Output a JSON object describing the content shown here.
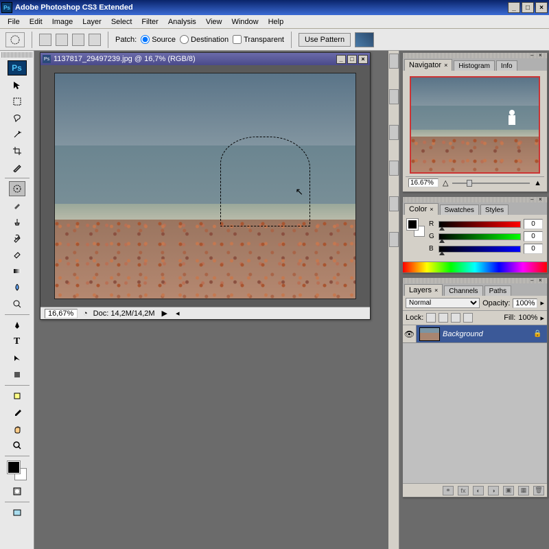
{
  "app": {
    "title": "Adobe Photoshop CS3 Extended",
    "logo": "Ps"
  },
  "menu": [
    "File",
    "Edit",
    "Image",
    "Layer",
    "Select",
    "Filter",
    "Analysis",
    "View",
    "Window",
    "Help"
  ],
  "options": {
    "patch_label": "Patch:",
    "source": "Source",
    "destination": "Destination",
    "transparent": "Transparent",
    "use_pattern": "Use Pattern"
  },
  "document": {
    "title": "1137817_29497239.jpg @ 16,7% (RGB/8)",
    "zoom": "16,67%",
    "doc_size": "Doc: 14,2M/14,2M"
  },
  "navigator": {
    "tab_nav": "Navigator",
    "tab_hist": "Histogram",
    "tab_info": "Info",
    "zoom": "16.67%"
  },
  "color": {
    "tab_color": "Color",
    "tab_swatches": "Swatches",
    "tab_styles": "Styles",
    "r_label": "R",
    "r_val": "0",
    "g_label": "G",
    "g_val": "0",
    "b_label": "B",
    "b_val": "0"
  },
  "layers": {
    "tab_layers": "Layers",
    "tab_channels": "Channels",
    "tab_paths": "Paths",
    "blend": "Normal",
    "opacity_label": "Opacity:",
    "opacity": "100%",
    "lock_label": "Lock:",
    "fill_label": "Fill:",
    "fill": "100%",
    "bg_layer": "Background"
  },
  "tools": {
    "move": "↖",
    "marquee": "⬚",
    "lasso": "⌇",
    "wand": "✦",
    "crop": "✂",
    "slice": "✄",
    "heal": "⌀",
    "brush": "🖌",
    "stamp": "⌘",
    "history": "↺",
    "eraser": "▱",
    "gradient": "▦",
    "blur": "●",
    "dodge": "◐",
    "pen": "✒",
    "type": "T",
    "path": "▶",
    "shape": "■",
    "notes": "✎",
    "eyedrop": "✐",
    "hand": "✋",
    "zoom": "🔍"
  }
}
